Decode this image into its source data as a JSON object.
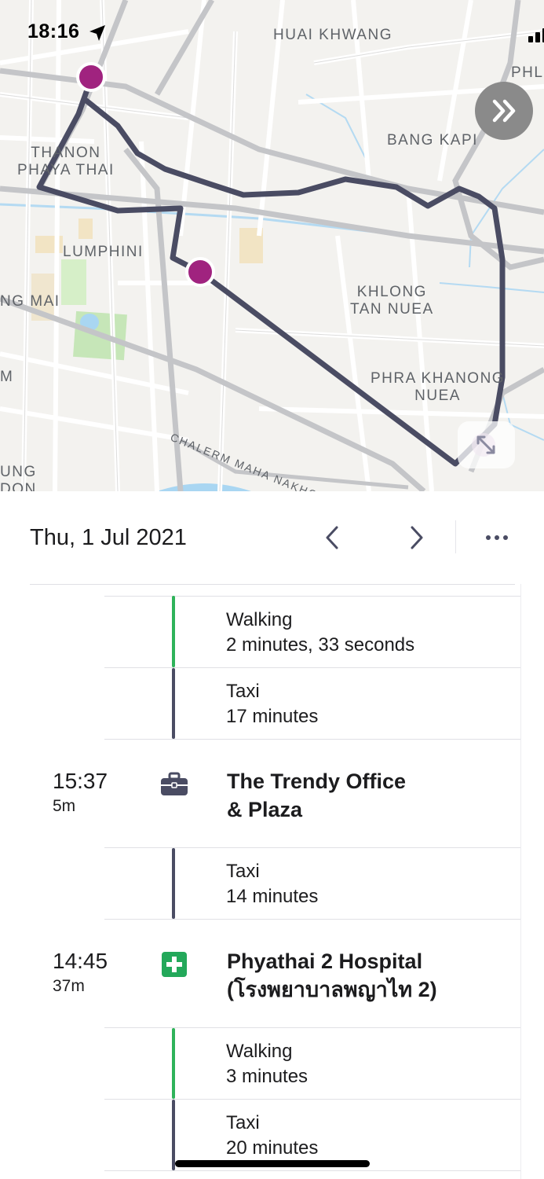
{
  "status_bar": {
    "time": "18:16"
  },
  "map": {
    "labels": {
      "huai_khwang": "HUAI KHWANG",
      "phl": "PHL",
      "thanon_phaya_thai": "THANON\nPHAYA THAI",
      "bang_kapi": "BANG KAPI",
      "lumphini": "LUMPHINI",
      "ng_mai": "NG MAI",
      "khlong_tan_nuea": "KHLONG\nTAN NUEA",
      "phra_khanong_nuea": "PHRA KHANONG\nNUEA",
      "m": "M",
      "ung_don": "UNG\nDON",
      "expressway": "CHALERM MAHA NAKHON EXPRESS"
    },
    "colors": {
      "route": "#4a4c63",
      "pin": "#a0237f",
      "water": "#a8d4f0",
      "park": "#cfe9c3"
    }
  },
  "header": {
    "date": "Thu, 1 Jul 2021"
  },
  "timeline": {
    "segments": [
      {
        "title": "Walking",
        "subtitle": "2 minutes, 33 seconds"
      },
      {
        "title": "Taxi",
        "subtitle": "17 minutes"
      },
      {
        "title": "Taxi",
        "subtitle": "14 minutes"
      },
      {
        "title": "Walking",
        "subtitle": "3 minutes"
      },
      {
        "title": "Taxi",
        "subtitle": "20 minutes"
      }
    ],
    "places": [
      {
        "time": "15:37",
        "duration": "5m",
        "name": "The Trendy Office\n& Plaza",
        "icon": "briefcase-icon"
      },
      {
        "time": "14:45",
        "duration": "37m",
        "name": "Phyathai 2 Hospital\n(โรงพยาบาลพญาไท 2)",
        "icon": "hospital-icon"
      }
    ],
    "colors": {
      "walking": "#2fb35a",
      "taxi": "#4a4c63",
      "hospital": "#23a85a",
      "briefcase": "#4a4c63"
    }
  }
}
